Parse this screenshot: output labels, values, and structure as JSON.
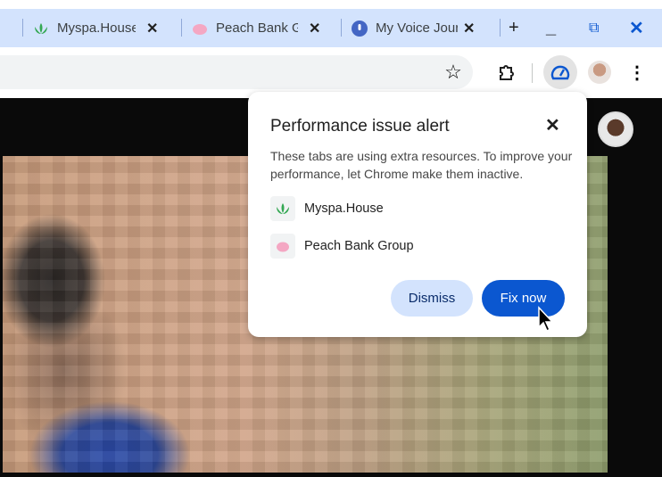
{
  "tabs": [
    {
      "title": "Myspa.House",
      "icon": "leaf-icon"
    },
    {
      "title": "Peach Bank Group",
      "icon": "piggy-bank-icon"
    },
    {
      "title": "My Voice Journal",
      "icon": "microphone-icon"
    }
  ],
  "popup": {
    "title": "Performance issue alert",
    "description": "These tabs are using extra resources. To improve your performance, let Chrome make them inactive.",
    "sites": [
      {
        "name": "Myspa.House",
        "icon": "leaf-icon"
      },
      {
        "name": "Peach Bank Group",
        "icon": "piggy-bank-icon"
      }
    ],
    "dismiss_label": "Dismiss",
    "fix_label": "Fix now"
  },
  "colors": {
    "accent": "#0b57d0",
    "tabstrip": "#d3e3fd",
    "leaf": "#34a853",
    "piggy": "#f4a7c3"
  }
}
